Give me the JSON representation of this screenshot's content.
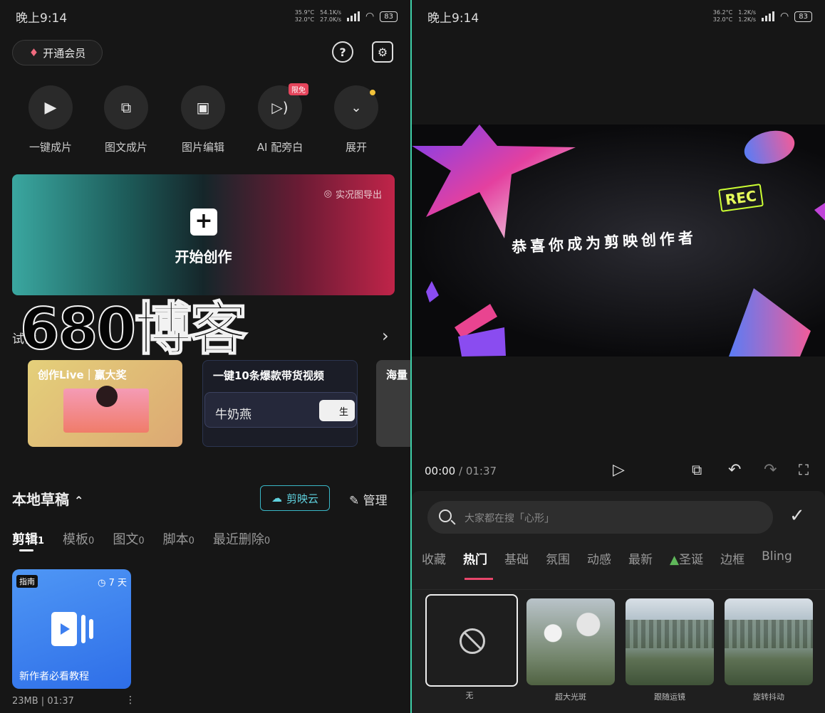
{
  "left": {
    "status": {
      "time": "晚上9:14",
      "temp_top": "35.9°C",
      "temp_bottom": "32.0°C",
      "speed_top": "54.1K/s",
      "speed_bottom": "27.0K/s",
      "battery": "83"
    },
    "vip_label": "开通会员",
    "tools": [
      {
        "label": "一键成片",
        "icon": "auto-video-icon"
      },
      {
        "label": "图文成片",
        "icon": "text-to-video-icon"
      },
      {
        "label": "图片编辑",
        "icon": "image-edit-icon"
      },
      {
        "label": "AI 配旁白",
        "icon": "ai-voiceover-icon"
      },
      {
        "label": "展开",
        "icon": "chevron-down-icon"
      }
    ],
    "free_badge": "限免",
    "hero": {
      "start_label": "开始创作",
      "live_label": "实况图导出"
    },
    "watermark": "680博客",
    "section_title": "试试",
    "cards": [
      {
        "title": "创作Live｜赢大奖"
      },
      {
        "title": "一键10条爆款带货视频",
        "input_text": "牛奶燕",
        "button_text": "生"
      },
      {
        "title": "海量"
      }
    ],
    "drafts": {
      "title": "本地草稿",
      "cloud_label": "剪映云",
      "manage_label": "管理",
      "tabs": [
        {
          "label": "剪辑",
          "count": "1"
        },
        {
          "label": "模板",
          "count": "0"
        },
        {
          "label": "图文",
          "count": "0"
        },
        {
          "label": "脚本",
          "count": "0"
        },
        {
          "label": "最近删除",
          "count": "0"
        }
      ],
      "item": {
        "tag": "指南",
        "days": "7 天",
        "caption": "新作者必看教程",
        "meta": "23MB | 01:37"
      }
    }
  },
  "right": {
    "status": {
      "time": "晚上9:14",
      "temp_top": "36.2°C",
      "temp_bottom": "32.0°C",
      "speed_top": "1.2K/s",
      "speed_bottom": "1.2K/s",
      "battery": "83"
    },
    "preview_text": "恭喜你成为剪映创作者",
    "rec_label": "REC",
    "time_current": "00:00",
    "time_total": "01:37",
    "search_placeholder": "大家都在搜「心形」",
    "categories": [
      "收藏",
      "热门",
      "基础",
      "氛围",
      "动感",
      "最新",
      "圣诞",
      "边框",
      "Bling"
    ],
    "effects": [
      {
        "label": "无"
      },
      {
        "label": "超大光斑"
      },
      {
        "label": "跟随运镜"
      },
      {
        "label": "旋转抖动"
      }
    ]
  }
}
